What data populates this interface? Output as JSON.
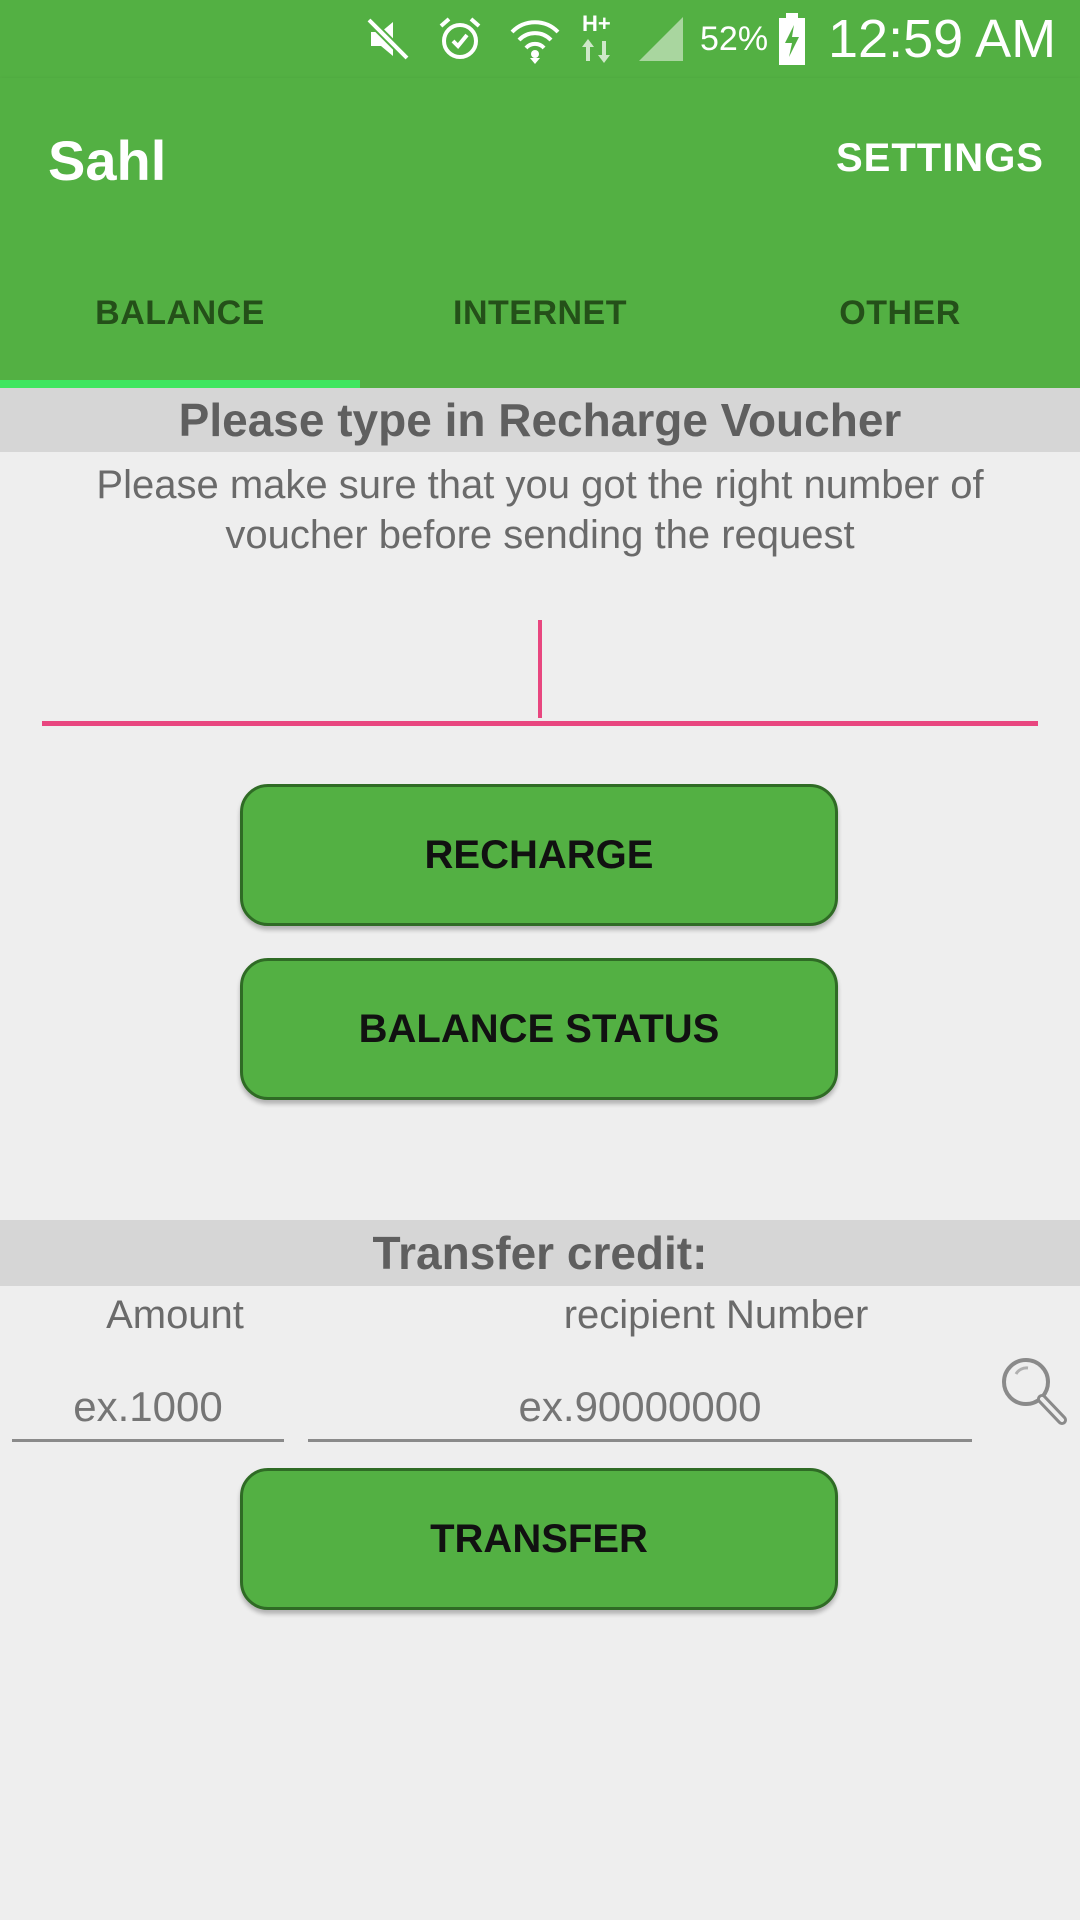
{
  "status_bar": {
    "battery_percent": "52%",
    "time": "12:59 AM",
    "icons": [
      "mute-icon",
      "alarm-icon",
      "wifi-icon",
      "hplus-data-icon",
      "cell-signal-icon",
      "battery-charging-icon"
    ]
  },
  "app_bar": {
    "title": "Sahl",
    "settings_label": "SETTINGS"
  },
  "tabs": [
    {
      "label": "BALANCE",
      "selected": true
    },
    {
      "label": "INTERNET",
      "selected": false
    },
    {
      "label": "OTHER",
      "selected": false
    }
  ],
  "recharge": {
    "header": "Please type in Recharge Voucher",
    "help_text": "Please make sure that you got the right number of voucher before sending the request",
    "voucher_value": "",
    "recharge_button": "RECHARGE",
    "balance_button": "BALANCE STATUS"
  },
  "transfer": {
    "header": "Transfer credit:",
    "amount_label": "Amount",
    "recipient_label": "recipient Number",
    "amount_placeholder": "ex.1000",
    "recipient_placeholder": "ex.90000000",
    "transfer_button": "TRANSFER"
  },
  "colors": {
    "primary": "#53b043",
    "tab_indicator": "#3fe65f",
    "accent": "#e8467f",
    "section_header_bg": "#d6d6d6",
    "background": "#eeeeee"
  }
}
